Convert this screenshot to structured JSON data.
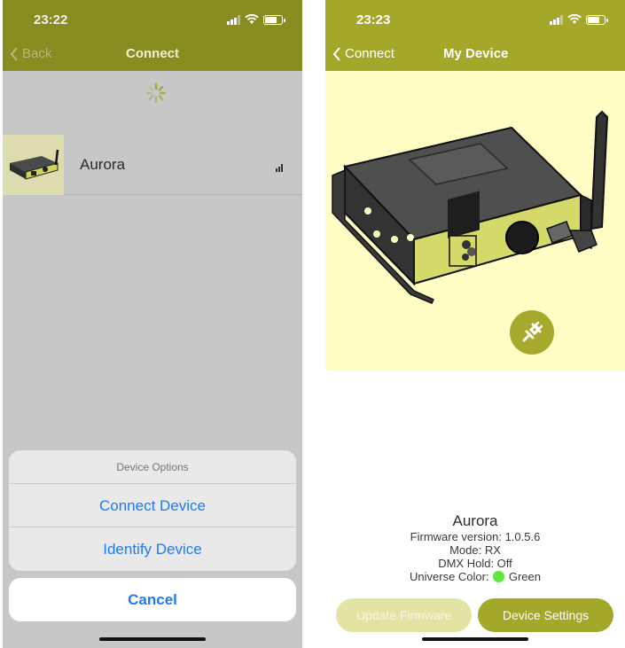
{
  "left": {
    "status_time": "23:22",
    "nav_back_label": "Back",
    "nav_title": "Connect",
    "device": {
      "name": "Aurora"
    },
    "sheet": {
      "title": "Device Options",
      "connect_label": "Connect Device",
      "identify_label": "Identify Device",
      "cancel_label": "Cancel"
    }
  },
  "right": {
    "status_time": "23:23",
    "nav_back_label": "Connect",
    "nav_title": "My Device",
    "device": {
      "name": "Aurora",
      "firmware": "Firmware version: 1.0.5.6",
      "mode": "Mode: RX",
      "dmx_hold": "DMX Hold: Off",
      "universe_color_label": "Universe Color:",
      "universe_color_value": "Green"
    },
    "buttons": {
      "update_firmware": "Update Firmware",
      "device_settings": "Device Settings"
    }
  },
  "colors": {
    "brand": "#a3a72a",
    "hero_background": "#ffffc5",
    "ios_blue": "#1d7bf5",
    "universe_green": "#5de83b"
  },
  "icons": [
    "signal-icon",
    "wifi-icon",
    "battery-icon",
    "chevron-left-icon",
    "spinner-icon",
    "link-icon"
  ]
}
